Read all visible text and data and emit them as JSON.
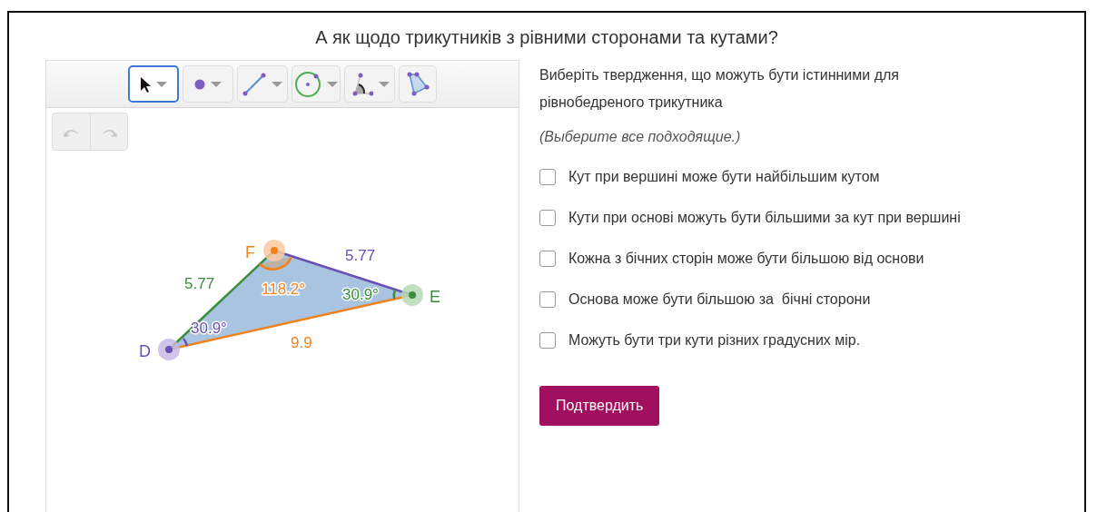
{
  "title": "А як щодо трикутників з рівними сторонами та кутами?",
  "applet": {
    "tools": [
      {
        "kind": "move",
        "selected": true
      },
      {
        "kind": "point",
        "selected": false
      },
      {
        "kind": "segment",
        "selected": false
      },
      {
        "kind": "circle",
        "selected": false
      },
      {
        "kind": "angle",
        "selected": false
      },
      {
        "kind": "polygon",
        "selected": false
      }
    ],
    "points": [
      {
        "label": "D"
      },
      {
        "label": "F"
      },
      {
        "label": "E"
      }
    ],
    "sides": [
      {
        "label": "5.77"
      },
      {
        "label": "5.77"
      },
      {
        "label": "9.9"
      }
    ],
    "angles": [
      {
        "label": "30.9°"
      },
      {
        "label": "118.2°"
      },
      {
        "label": "30.9°"
      }
    ]
  },
  "question": {
    "prompt": "Виберіть твердження, що можуть бути істинними для рівнобедреного трикутника",
    "hint": "(Выберите все подходящие.)",
    "options": [
      {
        "label": "Кут при вершині може бути найбільшим кутом",
        "checked": false
      },
      {
        "label": "Кути при основі можуть бути більшими за кут при вершині",
        "checked": false
      },
      {
        "label": "Кожна з бічних сторін може бути більшою від основи",
        "checked": false
      },
      {
        "label": "Основа може бути більшою за  бічні сторони",
        "checked": false
      },
      {
        "label": "Можуть бути три кути різних градусних мір.",
        "checked": false
      }
    ],
    "submit": "Подтвердить"
  }
}
